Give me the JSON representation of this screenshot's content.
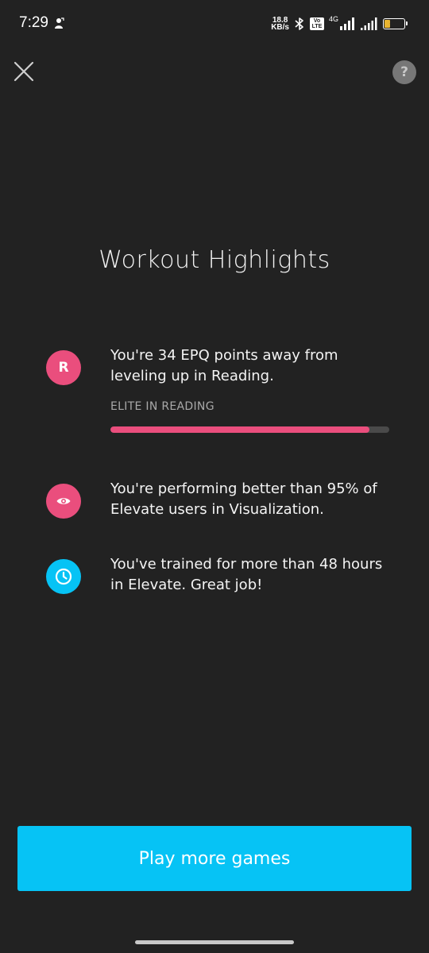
{
  "status_bar": {
    "time": "7:29",
    "net_speed_value": "18.8",
    "net_speed_unit": "KB/s",
    "volte_label": "Vo LTE",
    "network_type": "4G",
    "battery_level": "33",
    "battery_color": "#e8b431"
  },
  "header": {
    "close_icon": "close-icon",
    "help_label": "?"
  },
  "title": "Workout Highlights",
  "highlights": [
    {
      "icon": "letter-r",
      "icon_label": "R",
      "icon_color": "#ea4e7d",
      "text": "You're 34 EPQ points away from leveling up in Reading.",
      "level_label": "ELITE IN READING",
      "progress": 0.93
    },
    {
      "icon": "eye-icon",
      "icon_color": "#ea4e7d",
      "text": "You're performing better than 95% of Elevate users in Visualization."
    },
    {
      "icon": "clock-icon",
      "icon_color": "#06c3f5",
      "text": "You've trained for more than 48 hours in Elevate. Great job!"
    }
  ],
  "cta": {
    "label": "Play more games",
    "color": "#06c3f5"
  }
}
